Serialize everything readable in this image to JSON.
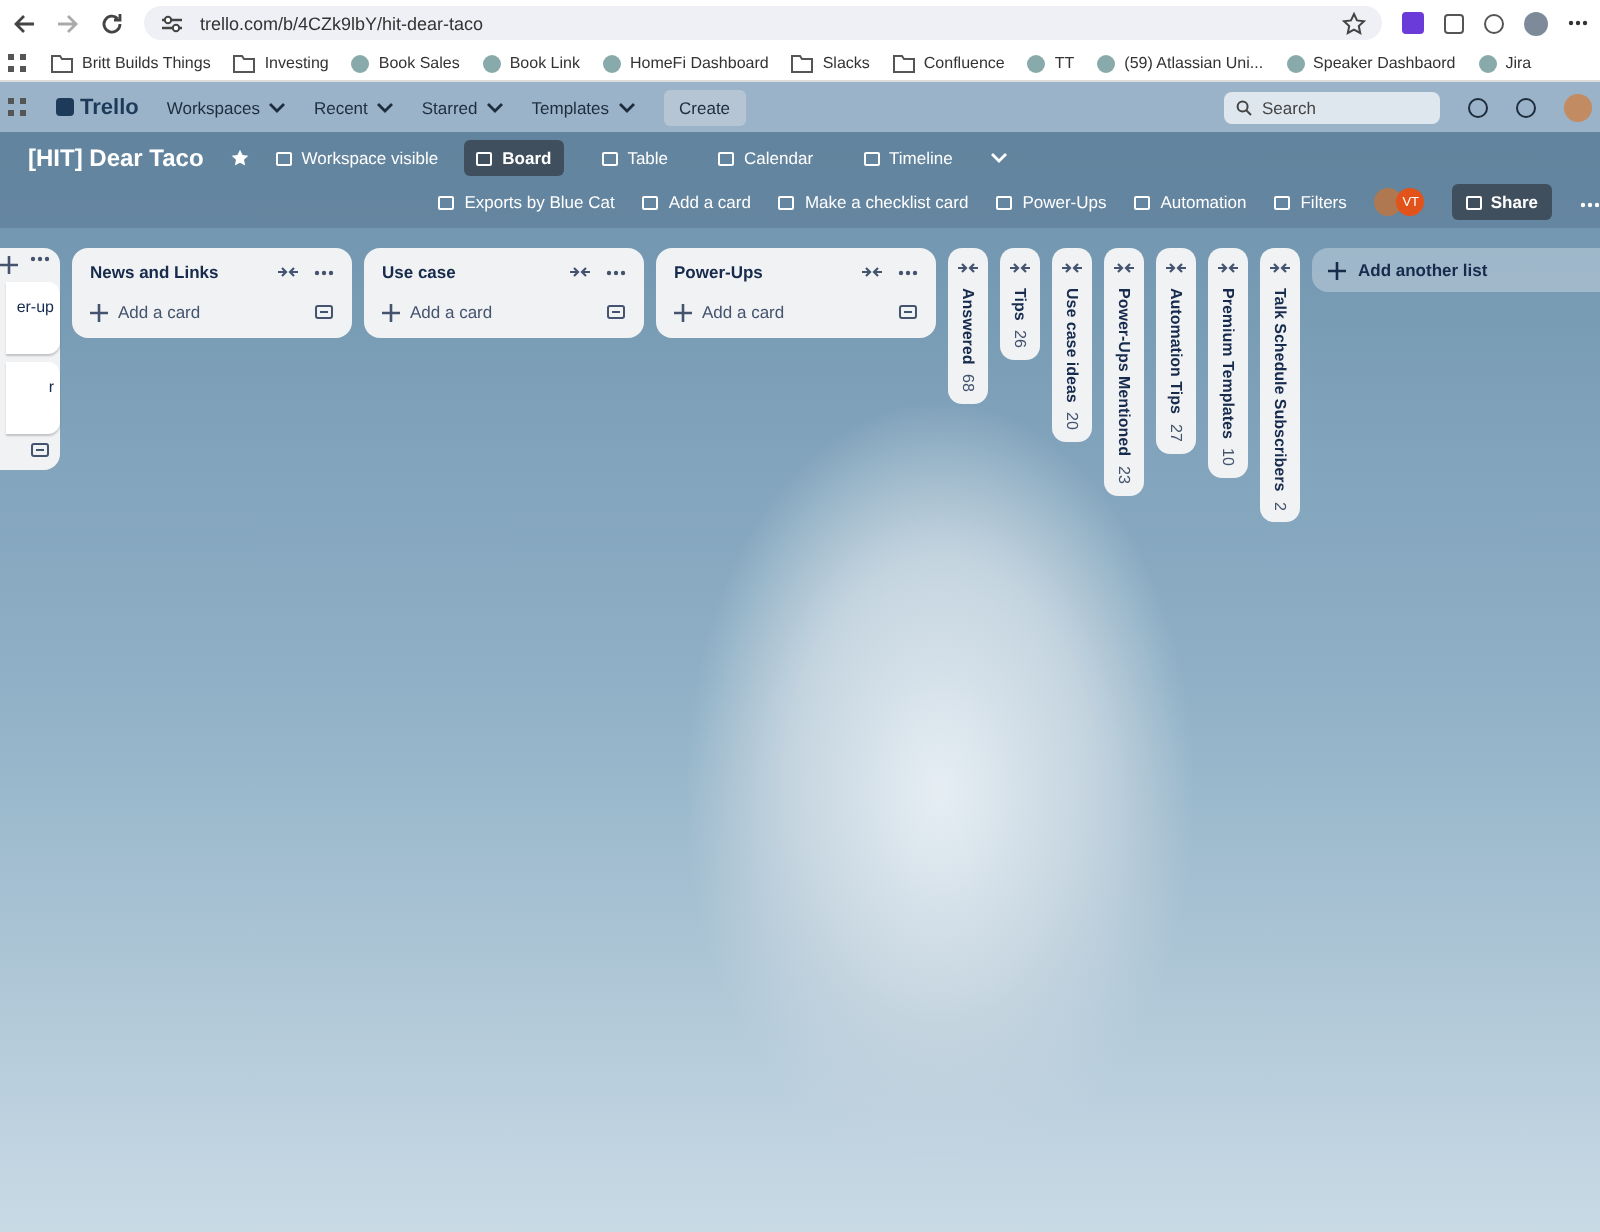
{
  "browser": {
    "url": "trello.com/b/4CZk9lbY/hit-dear-taco",
    "bookmarks": [
      {
        "kind": "folder",
        "label": "Britt Builds Things"
      },
      {
        "kind": "folder",
        "label": "Investing"
      },
      {
        "kind": "site",
        "label": "Book Sales"
      },
      {
        "kind": "site",
        "label": "Book Link"
      },
      {
        "kind": "site",
        "label": "HomeFi Dashboard"
      },
      {
        "kind": "folder",
        "label": "Slacks"
      },
      {
        "kind": "folder",
        "label": "Confluence"
      },
      {
        "kind": "site",
        "label": "TT"
      },
      {
        "kind": "site",
        "label": "(59) Atlassian Uni..."
      },
      {
        "kind": "site",
        "label": "Speaker Dashbaord"
      },
      {
        "kind": "site",
        "label": "Jira"
      }
    ]
  },
  "nav": {
    "logo": "Trello",
    "menus": [
      "Workspaces",
      "Recent",
      "Starred",
      "Templates"
    ],
    "create": "Create",
    "search_placeholder": "Search"
  },
  "board": {
    "title": "[HIT] Dear Taco",
    "visibility": "Workspace visible",
    "views": [
      {
        "label": "Board",
        "selected": true
      },
      {
        "label": "Table",
        "selected": false
      },
      {
        "label": "Calendar",
        "selected": false
      },
      {
        "label": "Timeline",
        "selected": false
      }
    ],
    "actions": [
      "Exports by Blue Cat",
      "Add a card",
      "Make a checklist card",
      "Power-Ups",
      "Automation",
      "Filters"
    ],
    "member_initials": "VT",
    "share": "Share"
  },
  "lists": [
    {
      "kind": "partial",
      "cards": [
        "er-up",
        "r"
      ]
    },
    {
      "kind": "open",
      "title": "News and Links",
      "add": "Add a card"
    },
    {
      "kind": "open",
      "title": "Use case",
      "add": "Add a card"
    },
    {
      "kind": "open",
      "title": "Power-Ups",
      "add": "Add a card"
    },
    {
      "kind": "collapsed",
      "title": "Answered",
      "count": "68"
    },
    {
      "kind": "collapsed",
      "title": "Tips",
      "count": "26"
    },
    {
      "kind": "collapsed",
      "title": "Use case ideas",
      "count": "20"
    },
    {
      "kind": "collapsed",
      "title": "Power-Ups Mentioned",
      "count": "23"
    },
    {
      "kind": "collapsed",
      "title": "Automation Tips",
      "count": "27"
    },
    {
      "kind": "collapsed",
      "title": "Premium Templates",
      "count": "10"
    },
    {
      "kind": "collapsed",
      "title": "Talk Schedule Subscribers",
      "count": "2"
    }
  ],
  "add_list": "Add another list"
}
